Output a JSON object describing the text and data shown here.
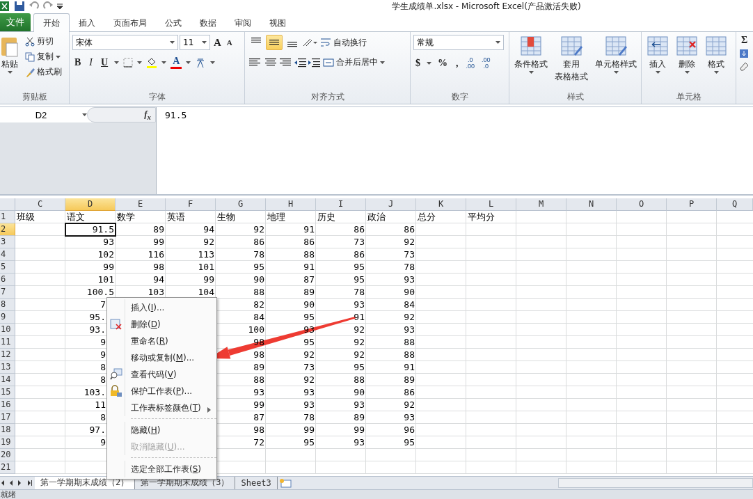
{
  "window": {
    "title": "学生成绩单.xlsx  -  Microsoft Excel(产品激活失败)"
  },
  "ribbon_tabs": [
    {
      "label": "文件",
      "kind": "file",
      "selected": false
    },
    {
      "label": "开始",
      "kind": "tab",
      "selected": true
    },
    {
      "label": "插入",
      "kind": "tab",
      "selected": false
    },
    {
      "label": "页面布局",
      "kind": "tab",
      "selected": false
    },
    {
      "label": "公式",
      "kind": "tab",
      "selected": false
    },
    {
      "label": "数据",
      "kind": "tab",
      "selected": false
    },
    {
      "label": "审阅",
      "kind": "tab",
      "selected": false
    },
    {
      "label": "视图",
      "kind": "tab",
      "selected": false
    }
  ],
  "clipboard": {
    "paste": "粘贴",
    "cut": "剪切",
    "copy": "复制",
    "painter": "格式刷",
    "label": "剪贴板"
  },
  "font": {
    "name": "宋体",
    "size": "11",
    "grow": "A",
    "shrink": "A",
    "bold": "B",
    "italic": "I",
    "underline": "U",
    "color_letter": "A",
    "label": "字体"
  },
  "alignment": {
    "vertical": [
      {
        "selected": false
      },
      {
        "selected": true
      },
      {
        "selected": false
      }
    ],
    "wrap": "自动换行",
    "merge": "合并后居中",
    "label": "对齐方式"
  },
  "number": {
    "format": "常规",
    "currency": "$",
    "percent": "%",
    "comma": ",",
    "decimals": [
      {
        "top": ".0",
        "bottom": ".00"
      },
      {
        "top": ".00",
        "bottom": ".0"
      }
    ],
    "label": "数字"
  },
  "styles": {
    "conditional": "条件格式",
    "table": [
      "套用",
      "表格格式"
    ],
    "cell_styles": "单元格样式",
    "label": "样式"
  },
  "cells": {
    "insert": "插入",
    "delete": "删除",
    "format": "格式",
    "label": "单元格"
  },
  "editing": {
    "sum": "Σ"
  },
  "formula_bar": {
    "name_box": "D2",
    "fx": "f$_{x}$",
    "value": "91.5"
  },
  "columns": [
    {
      "label": "C",
      "selected": false
    },
    {
      "label": "D",
      "selected": true
    },
    {
      "label": "E",
      "selected": false
    },
    {
      "label": "F",
      "selected": false
    },
    {
      "label": "G",
      "selected": false
    },
    {
      "label": "H",
      "selected": false
    },
    {
      "label": "I",
      "selected": false
    },
    {
      "label": "J",
      "selected": false
    },
    {
      "label": "K",
      "selected": false
    },
    {
      "label": "L",
      "selected": false
    },
    {
      "label": "M",
      "selected": false
    },
    {
      "label": "N",
      "selected": false
    },
    {
      "label": "O",
      "selected": false
    },
    {
      "label": "P",
      "selected": false
    },
    {
      "label": "Q",
      "selected": false
    }
  ],
  "rows": [
    {
      "header": "1",
      "kind": "header",
      "selected": false,
      "cells": [
        "班级",
        "语文",
        "数学",
        "英语",
        "生物",
        "地理",
        "历史",
        "政治",
        "总分",
        "平均分"
      ]
    },
    {
      "header": "2",
      "kind": "data",
      "selected": true,
      "cells": [
        null,
        "91.5",
        "89",
        "94",
        "92",
        "91",
        "86",
        "86"
      ]
    },
    {
      "header": "3",
      "kind": "data",
      "selected": false,
      "cells": [
        null,
        "93",
        "99",
        "92",
        "86",
        "86",
        "73",
        "92"
      ]
    },
    {
      "header": "4",
      "kind": "data",
      "selected": false,
      "cells": [
        null,
        "102",
        "116",
        "113",
        "78",
        "88",
        "86",
        "73"
      ]
    },
    {
      "header": "5",
      "kind": "data",
      "selected": false,
      "cells": [
        null,
        "99",
        "98",
        "101",
        "95",
        "91",
        "95",
        "78"
      ]
    },
    {
      "header": "6",
      "kind": "data",
      "selected": false,
      "cells": [
        null,
        "101",
        "94",
        "99",
        "90",
        "87",
        "95",
        "93"
      ]
    },
    {
      "header": "7",
      "kind": "data",
      "selected": false,
      "cells": [
        null,
        "100.5",
        "103",
        "104",
        "88",
        "89",
        "78",
        "90"
      ]
    },
    {
      "header": "8",
      "kind": "data",
      "selected": false,
      "cells": [
        null,
        "7",
        null,
        null,
        "82",
        "90",
        "93",
        "84"
      ]
    },
    {
      "header": "9",
      "kind": "data",
      "selected": false,
      "cells": [
        null,
        "95.",
        null,
        null,
        "84",
        "95",
        "91",
        "92"
      ]
    },
    {
      "header": "10",
      "kind": "data",
      "selected": false,
      "cells": [
        null,
        "93.",
        null,
        null,
        "100",
        "93",
        "92",
        "93"
      ]
    },
    {
      "header": "11",
      "kind": "data",
      "selected": false,
      "cells": [
        null,
        "9",
        null,
        null,
        "98",
        "95",
        "92",
        "88"
      ]
    },
    {
      "header": "12",
      "kind": "data",
      "selected": false,
      "cells": [
        null,
        "9",
        null,
        null,
        "98",
        "92",
        "92",
        "88"
      ]
    },
    {
      "header": "13",
      "kind": "data",
      "selected": false,
      "cells": [
        null,
        "8",
        null,
        null,
        "89",
        "73",
        "95",
        "91"
      ]
    },
    {
      "header": "14",
      "kind": "data",
      "selected": false,
      "cells": [
        null,
        "8",
        null,
        null,
        "88",
        "92",
        "88",
        "89"
      ]
    },
    {
      "header": "15",
      "kind": "data",
      "selected": false,
      "cells": [
        null,
        "103.",
        null,
        null,
        "93",
        "93",
        "90",
        "86"
      ]
    },
    {
      "header": "16",
      "kind": "data",
      "selected": false,
      "cells": [
        null,
        "11",
        null,
        null,
        "99",
        "93",
        "93",
        "92"
      ]
    },
    {
      "header": "17",
      "kind": "data",
      "selected": false,
      "cells": [
        null,
        "8",
        null,
        null,
        "87",
        "78",
        "89",
        "93"
      ]
    },
    {
      "header": "18",
      "kind": "data",
      "selected": false,
      "cells": [
        null,
        "97.",
        null,
        null,
        "98",
        "99",
        "99",
        "96"
      ]
    },
    {
      "header": "19",
      "kind": "data",
      "selected": false,
      "cells": [
        null,
        "9",
        null,
        null,
        "72",
        "95",
        "93",
        "95"
      ]
    },
    {
      "header": "20",
      "kind": "data",
      "selected": false
    },
    {
      "header": "21",
      "kind": "data",
      "selected": false
    }
  ],
  "context_menu": [
    {
      "kind": "item",
      "before": "插入(",
      "key": "I",
      "after": ")...",
      "disabled": false
    },
    {
      "kind": "item",
      "before": "删除(",
      "key": "D",
      "after": ")",
      "disabled": false
    },
    {
      "kind": "item",
      "before": "重命名(",
      "key": "R",
      "after": ")",
      "disabled": false
    },
    {
      "kind": "item",
      "before": "移动或复制(",
      "key": "M",
      "after": ")...",
      "disabled": false
    },
    {
      "kind": "item",
      "before": "查看代码(",
      "key": "V",
      "after": ")",
      "disabled": false
    },
    {
      "kind": "item",
      "before": "保护工作表(",
      "key": "P",
      "after": ")...",
      "disabled": false
    },
    {
      "kind": "submenu",
      "before": "工作表标签颜色(",
      "key": "T",
      "after": ")",
      "disabled": false
    },
    {
      "kind": "separator"
    },
    {
      "kind": "item",
      "before": "隐藏(",
      "key": "H",
      "after": ")",
      "disabled": false
    },
    {
      "kind": "item",
      "before": "取消隐藏(",
      "key": "U",
      "after": ")...",
      "disabled": true
    },
    {
      "kind": "separator"
    },
    {
      "kind": "item",
      "before": "选定全部工作表(",
      "key": "S",
      "after": ")",
      "disabled": false
    }
  ],
  "sheet_tabs": [
    {
      "label": "第一学期期末成绩（2）",
      "selected": true
    },
    {
      "label": "第一学期期末成绩（3）",
      "selected": false
    },
    {
      "label": "Sheet3",
      "selected": false
    }
  ],
  "status_bar": {
    "text": "就绪"
  }
}
